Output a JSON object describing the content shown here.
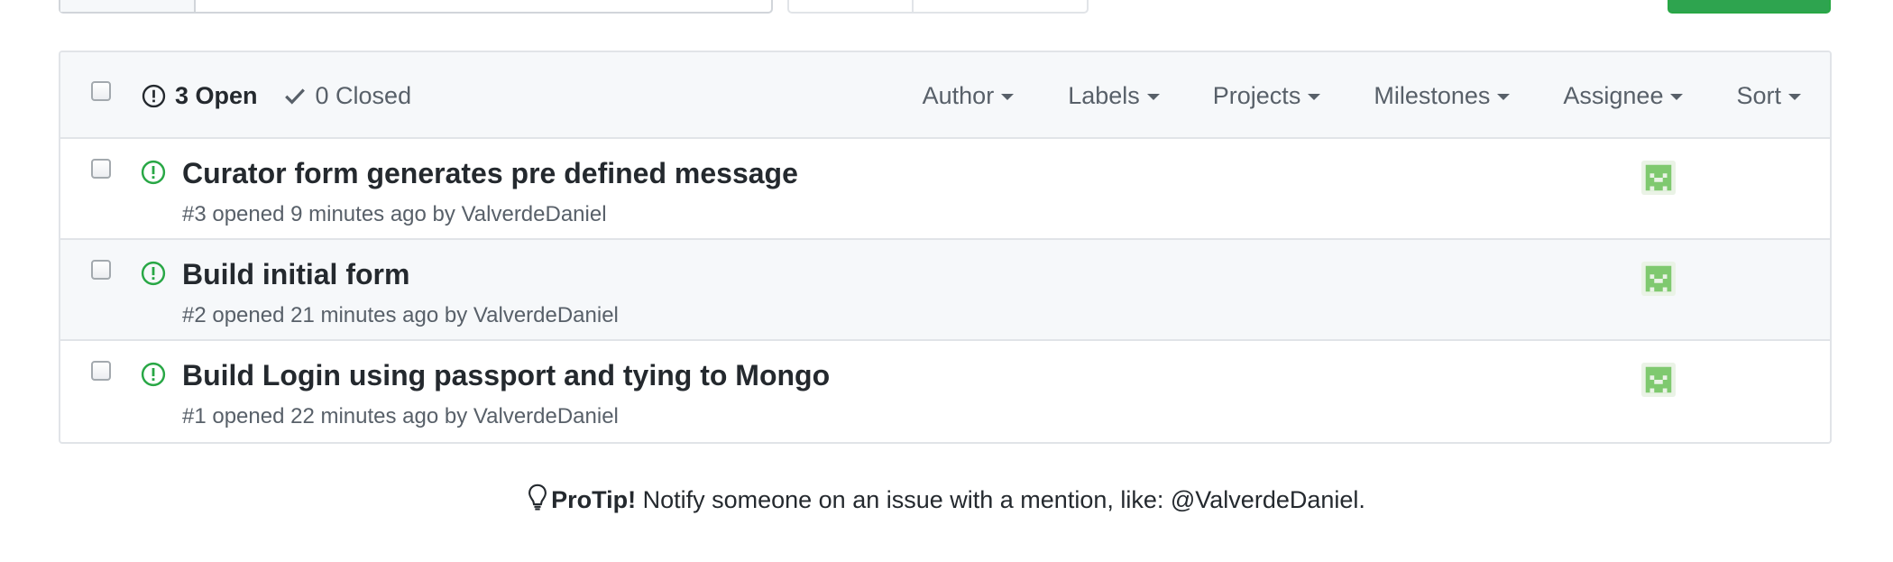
{
  "issues_header": {
    "open_count_label": "3 Open",
    "closed_count_label": "0 Closed",
    "filters": [
      "Author",
      "Labels",
      "Projects",
      "Milestones",
      "Assignee",
      "Sort"
    ]
  },
  "issues": [
    {
      "title": "Curator form generates pre defined message",
      "meta": "#3 opened 9 minutes ago by ValverdeDaniel"
    },
    {
      "title": "Build initial form",
      "meta": "#2 opened 21 minutes ago by ValverdeDaniel"
    },
    {
      "title": "Build Login using passport and tying to Mongo",
      "meta": "#1 opened 22 minutes ago by ValverdeDaniel"
    }
  ],
  "protip": {
    "label": "ProTip!",
    "text": " Notify someone on an issue with a mention, like: @ValverdeDaniel."
  },
  "icons": {
    "open_issue": "issue-opened-icon",
    "closed": "check-icon",
    "protip": "light-bulb-icon"
  },
  "colors": {
    "open_green": "#28a745",
    "avatar_green": "#7fc96f",
    "header_bg": "#f6f8fa"
  }
}
